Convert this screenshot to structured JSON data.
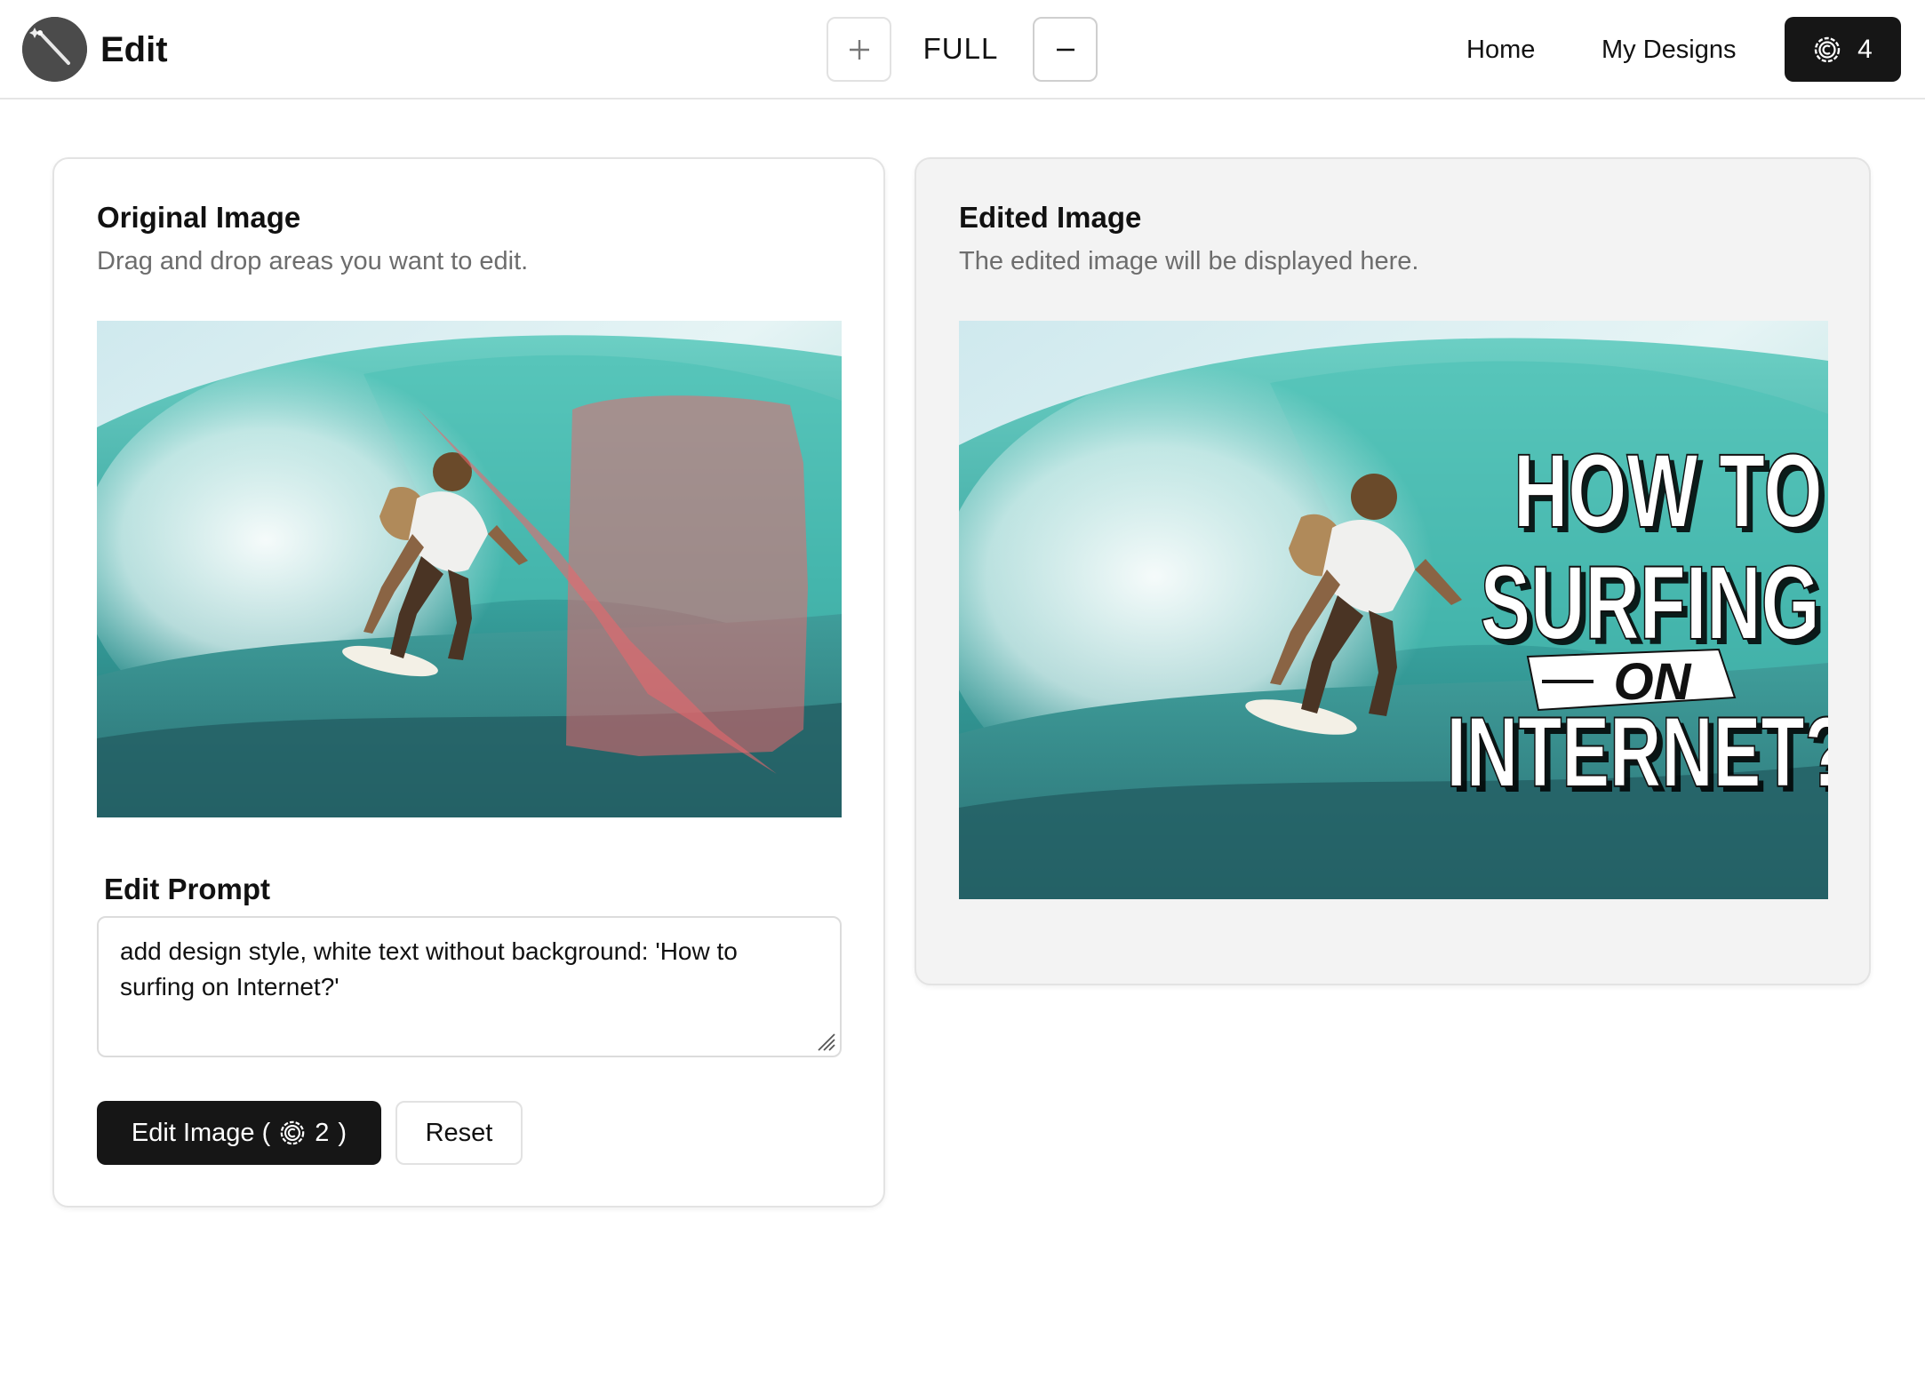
{
  "header": {
    "app_title": "Edit",
    "zoom_label": "FULL",
    "nav": {
      "home": "Home",
      "my_designs": "My Designs"
    },
    "credits": "4"
  },
  "original_card": {
    "title": "Original Image",
    "subtitle": "Drag and drop areas you want to edit.",
    "prompt_label": "Edit Prompt",
    "prompt_value": "add design style, white text without background: 'How to surfing on Internet?'",
    "edit_button": {
      "label_start": "Edit Image (",
      "credits": "2",
      "label_end": ")"
    },
    "reset_button": "Reset"
  },
  "edited_card": {
    "title": "Edited Image",
    "subtitle": "The edited image will be displayed here.",
    "overlay_text": {
      "line1": "HOW TO",
      "line2": "SURFING",
      "line3": "ON",
      "line4": "INTERNET?"
    }
  },
  "colors": {
    "primary_button": "#161616",
    "mask_overlay": "#e8676d",
    "edited_panel_bg": "#f3f3f3",
    "water": "#4fb6ad"
  },
  "icons": [
    "magic-wand-icon",
    "plus-icon",
    "minus-icon",
    "credit-coin-icon",
    "resize-grip-icon"
  ]
}
